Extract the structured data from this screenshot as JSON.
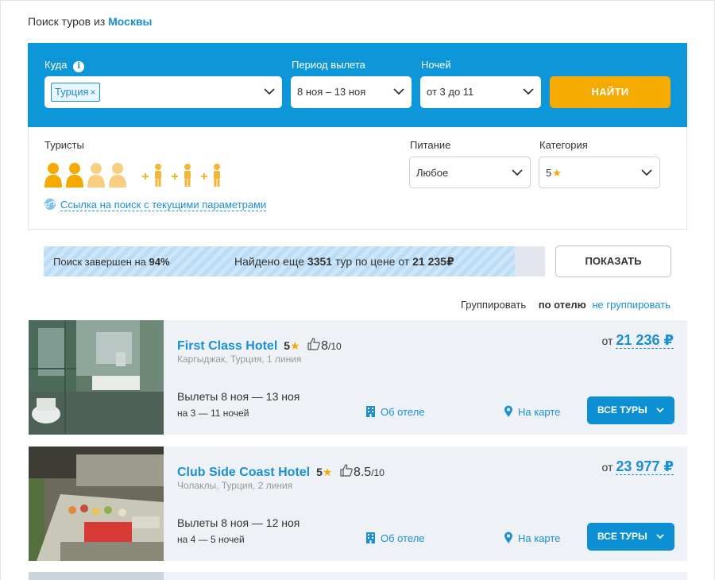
{
  "header": {
    "prefix": "Поиск туров из",
    "city": "Москвы"
  },
  "search": {
    "destination_label": "Куда",
    "destination_tag": "Турция",
    "period_label": "Период вылета",
    "period_value": "8 ноя – 13 ноя",
    "nights_label": "Ночей",
    "nights_value": "от 3 до 11",
    "find_button": "НАЙТИ",
    "tourists_label": "Туристы",
    "meal_label": "Питание",
    "meal_value": "Любое",
    "category_label": "Категория",
    "category_value": "5",
    "link_text": "Ссылка на поиск с текущими параметрами",
    "colors": {
      "panel": "#0d97d9",
      "accent": "#f4aa00",
      "link": "#1a8fd3"
    }
  },
  "progress": {
    "prefix": "Поиск завершен на",
    "percent": "94%",
    "percent_value": 0.94,
    "found_prefix": "Найдено еще",
    "found_count": "3351",
    "found_mid": "тур по цене от",
    "found_price": "21 235₽",
    "show_button": "ПОКАЗАТЬ"
  },
  "grouping": {
    "label": "Группировать",
    "active": "по отелю",
    "alternative": "не группировать"
  },
  "hotels": [
    {
      "name": "First Class Hotel",
      "stars": "5",
      "rating": "8",
      "rating_of": "/10",
      "location": "Каргыджак, Турция, 1 линия",
      "dates": "Вылеты 8 ноя — 13 ноя",
      "nights": "на 3  —  11 ночей",
      "about": "Об отеле",
      "map": "На карте",
      "price_prefix": "от",
      "price": "21 236 ₽",
      "tours_button": "ВСЕ ТУРЫ"
    },
    {
      "name": "Club Side Coast Hotel",
      "stars": "5",
      "rating": "8.5",
      "rating_of": "/10",
      "location": "Чолаклы, Турция, 2 линия",
      "dates": "Вылеты 8 ноя — 12 ноя",
      "nights": "на 4  —  5 ночей",
      "about": "Об отеле",
      "map": "На карте",
      "price_prefix": "от",
      "price": "23 977 ₽",
      "tours_button": "ВСЕ ТУРЫ"
    }
  ]
}
